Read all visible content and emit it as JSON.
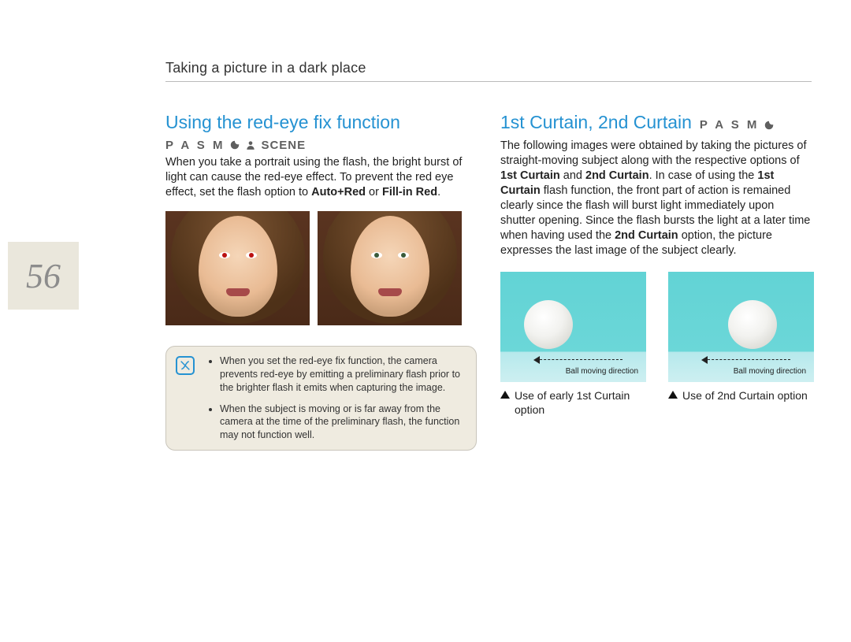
{
  "page_header": "Taking a picture in a dark place",
  "page_number": "56",
  "left": {
    "title": "Using the red-eye fix function",
    "modes": "P A S M",
    "scene_label": "SCENE",
    "body_parts": [
      "When you take a portrait using the flash, the bright burst of light can cause the red-eye effect. To prevent the red eye effect, set the flash option to ",
      "Auto+Red",
      " or ",
      "Fill-in Red",
      "."
    ],
    "portrait_alt_1": "Portrait with red-eye",
    "portrait_alt_2": "Portrait without red-eye",
    "note_bullets": [
      "When you set the red-eye fix function, the camera prevents red-eye by emitting a preliminary flash prior to the brighter flash it emits when capturing the image.",
      "When the subject is moving or is far away from the camera at the time of the preliminary flash, the function may not function well."
    ]
  },
  "right": {
    "title": "1st Curtain, 2nd Curtain",
    "modes": "P A S M",
    "body_parts": [
      "The following images were obtained by taking the pictures of straight-moving subject along with the respective options of ",
      "1st Curtain",
      " and ",
      "2nd Curtain",
      ". In case of using the ",
      "1st Curtain",
      " flash function, the front part of action is remained clearly since the flash will burst light immediately upon shutter opening. Since the flash bursts the light at a later time when having used the ",
      "2nd Curtain",
      " option, the picture expresses the last image of the subject clearly."
    ],
    "ball_label": "Ball moving direction",
    "caption_1": "Use of early 1st Curtain option",
    "caption_2": "Use of 2nd Curtain option"
  }
}
